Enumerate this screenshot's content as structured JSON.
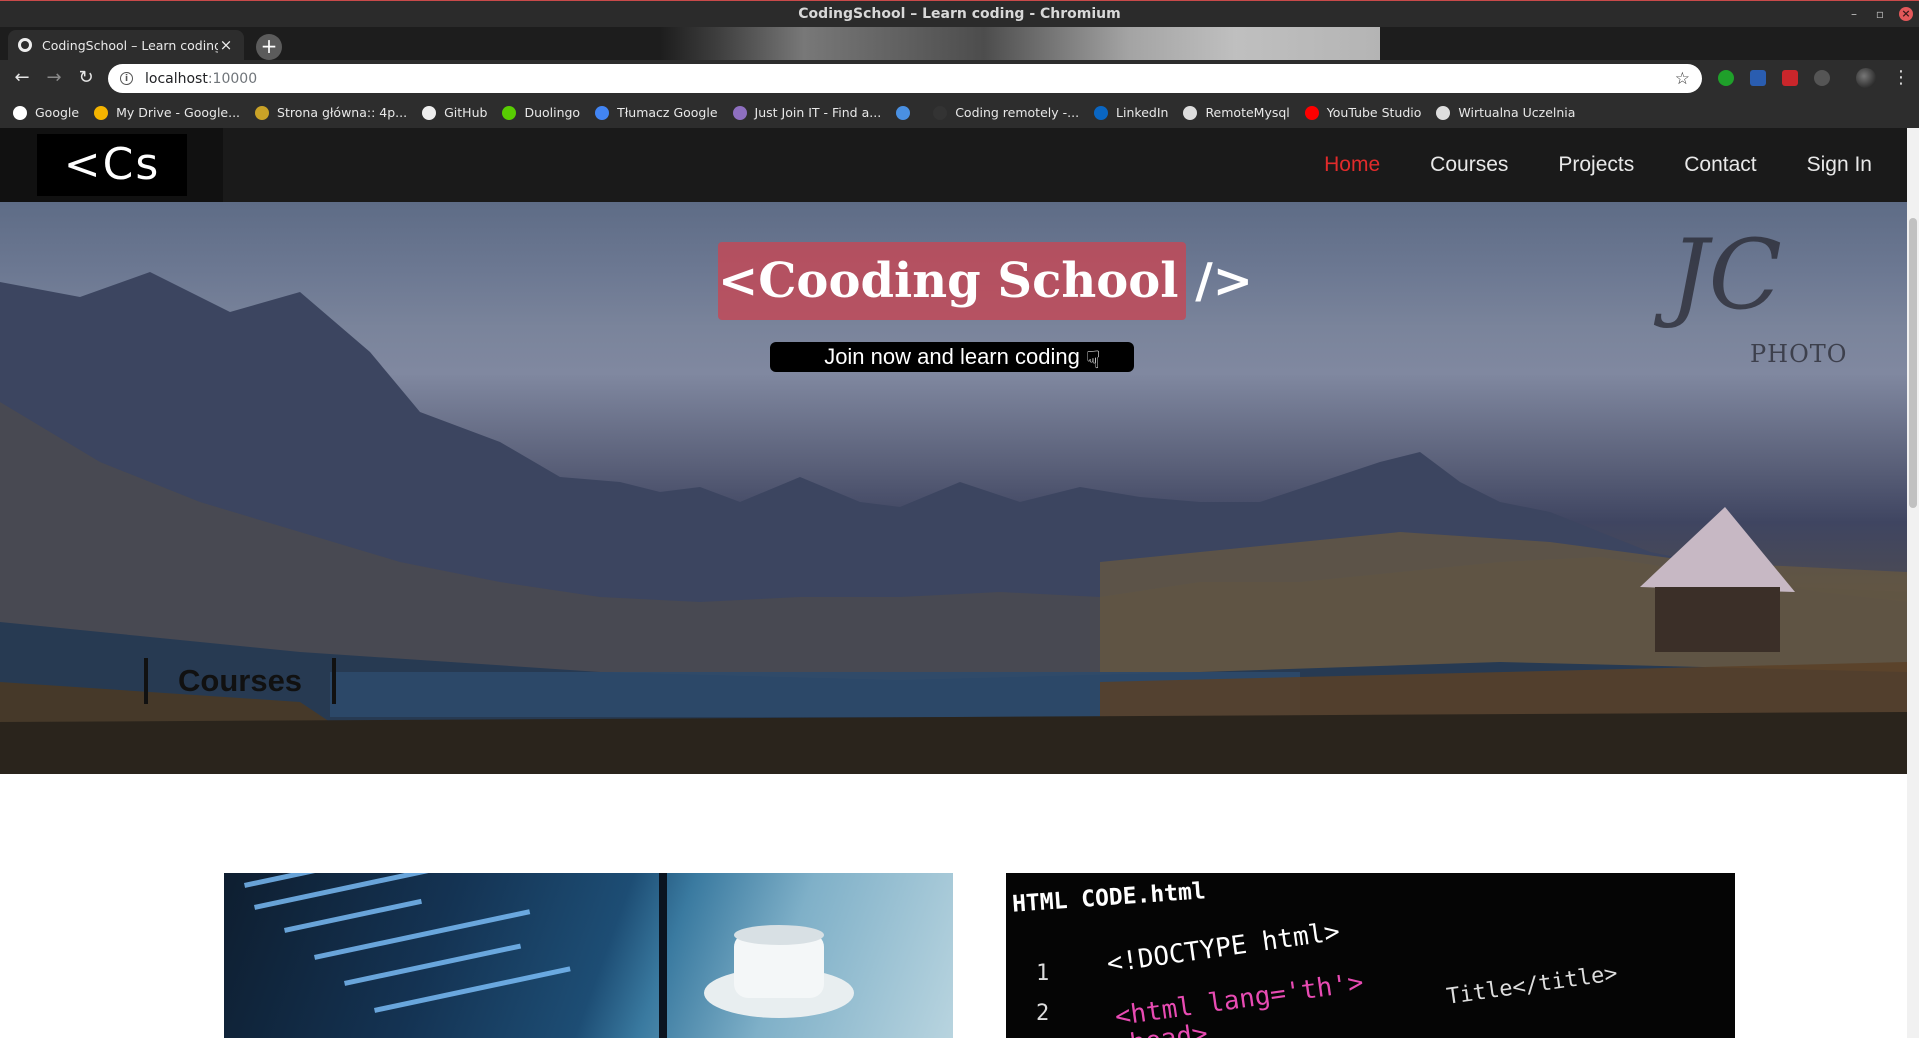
{
  "window": {
    "title": "CodingSchool – Learn coding - Chromium"
  },
  "tab": {
    "title": "CodingSchool – Learn coding"
  },
  "toolbar": {
    "url_host": "localhost",
    "url_port": ":10000"
  },
  "bookmarks": [
    {
      "label": "Google",
      "color": "#ffffff",
      "icon": "google-icon"
    },
    {
      "label": "My Drive - Google...",
      "color": "#f4b400",
      "icon": "drive-icon"
    },
    {
      "label": "Strona główna:: 4p...",
      "color": "#c9a227",
      "icon": "forum-icon"
    },
    {
      "label": "GitHub",
      "color": "#eeeeee",
      "icon": "github-icon"
    },
    {
      "label": "Duolingo",
      "color": "#58cc02",
      "icon": "duolingo-icon"
    },
    {
      "label": "Tłumacz Google",
      "color": "#4285f4",
      "icon": "translate-icon"
    },
    {
      "label": "Just Join IT - Find a...",
      "color": "#8e6fc0",
      "icon": "justjoin-icon"
    },
    {
      "label": "",
      "color": "#4a90e2",
      "icon": "flag-icon"
    },
    {
      "label": "Coding remotely -...",
      "color": "#333333",
      "icon": "horse-icon"
    },
    {
      "label": "LinkedIn",
      "color": "#0a66c2",
      "icon": "linkedin-icon"
    },
    {
      "label": "RemoteMysql",
      "color": "#dddddd",
      "icon": "globe-icon"
    },
    {
      "label": "YouTube Studio",
      "color": "#ff0000",
      "icon": "youtube-icon"
    },
    {
      "label": "Wirtualna Uczelnia",
      "color": "#dddddd",
      "icon": "globe-icon"
    }
  ],
  "site": {
    "logo": "<Cs />",
    "nav": [
      "Home",
      "Courses",
      "Projects",
      "Contact",
      "Sign In"
    ],
    "active_nav": "Home",
    "accent": "#e12b2b",
    "hero_title": "<Cooding School />",
    "hero_cta": "Join now and learn coding",
    "watermark_sig": "JC",
    "watermark_photo": "PHOTO",
    "section_title": "Courses"
  },
  "cards": {
    "card2_heading": "HTML CODE.html",
    "card2_lines": [
      "<!DOCTYPE html>",
      "<html lang='th'>",
      "<head>",
      "Title</title>"
    ],
    "card2_line_numbers": [
      "1",
      "2"
    ]
  }
}
